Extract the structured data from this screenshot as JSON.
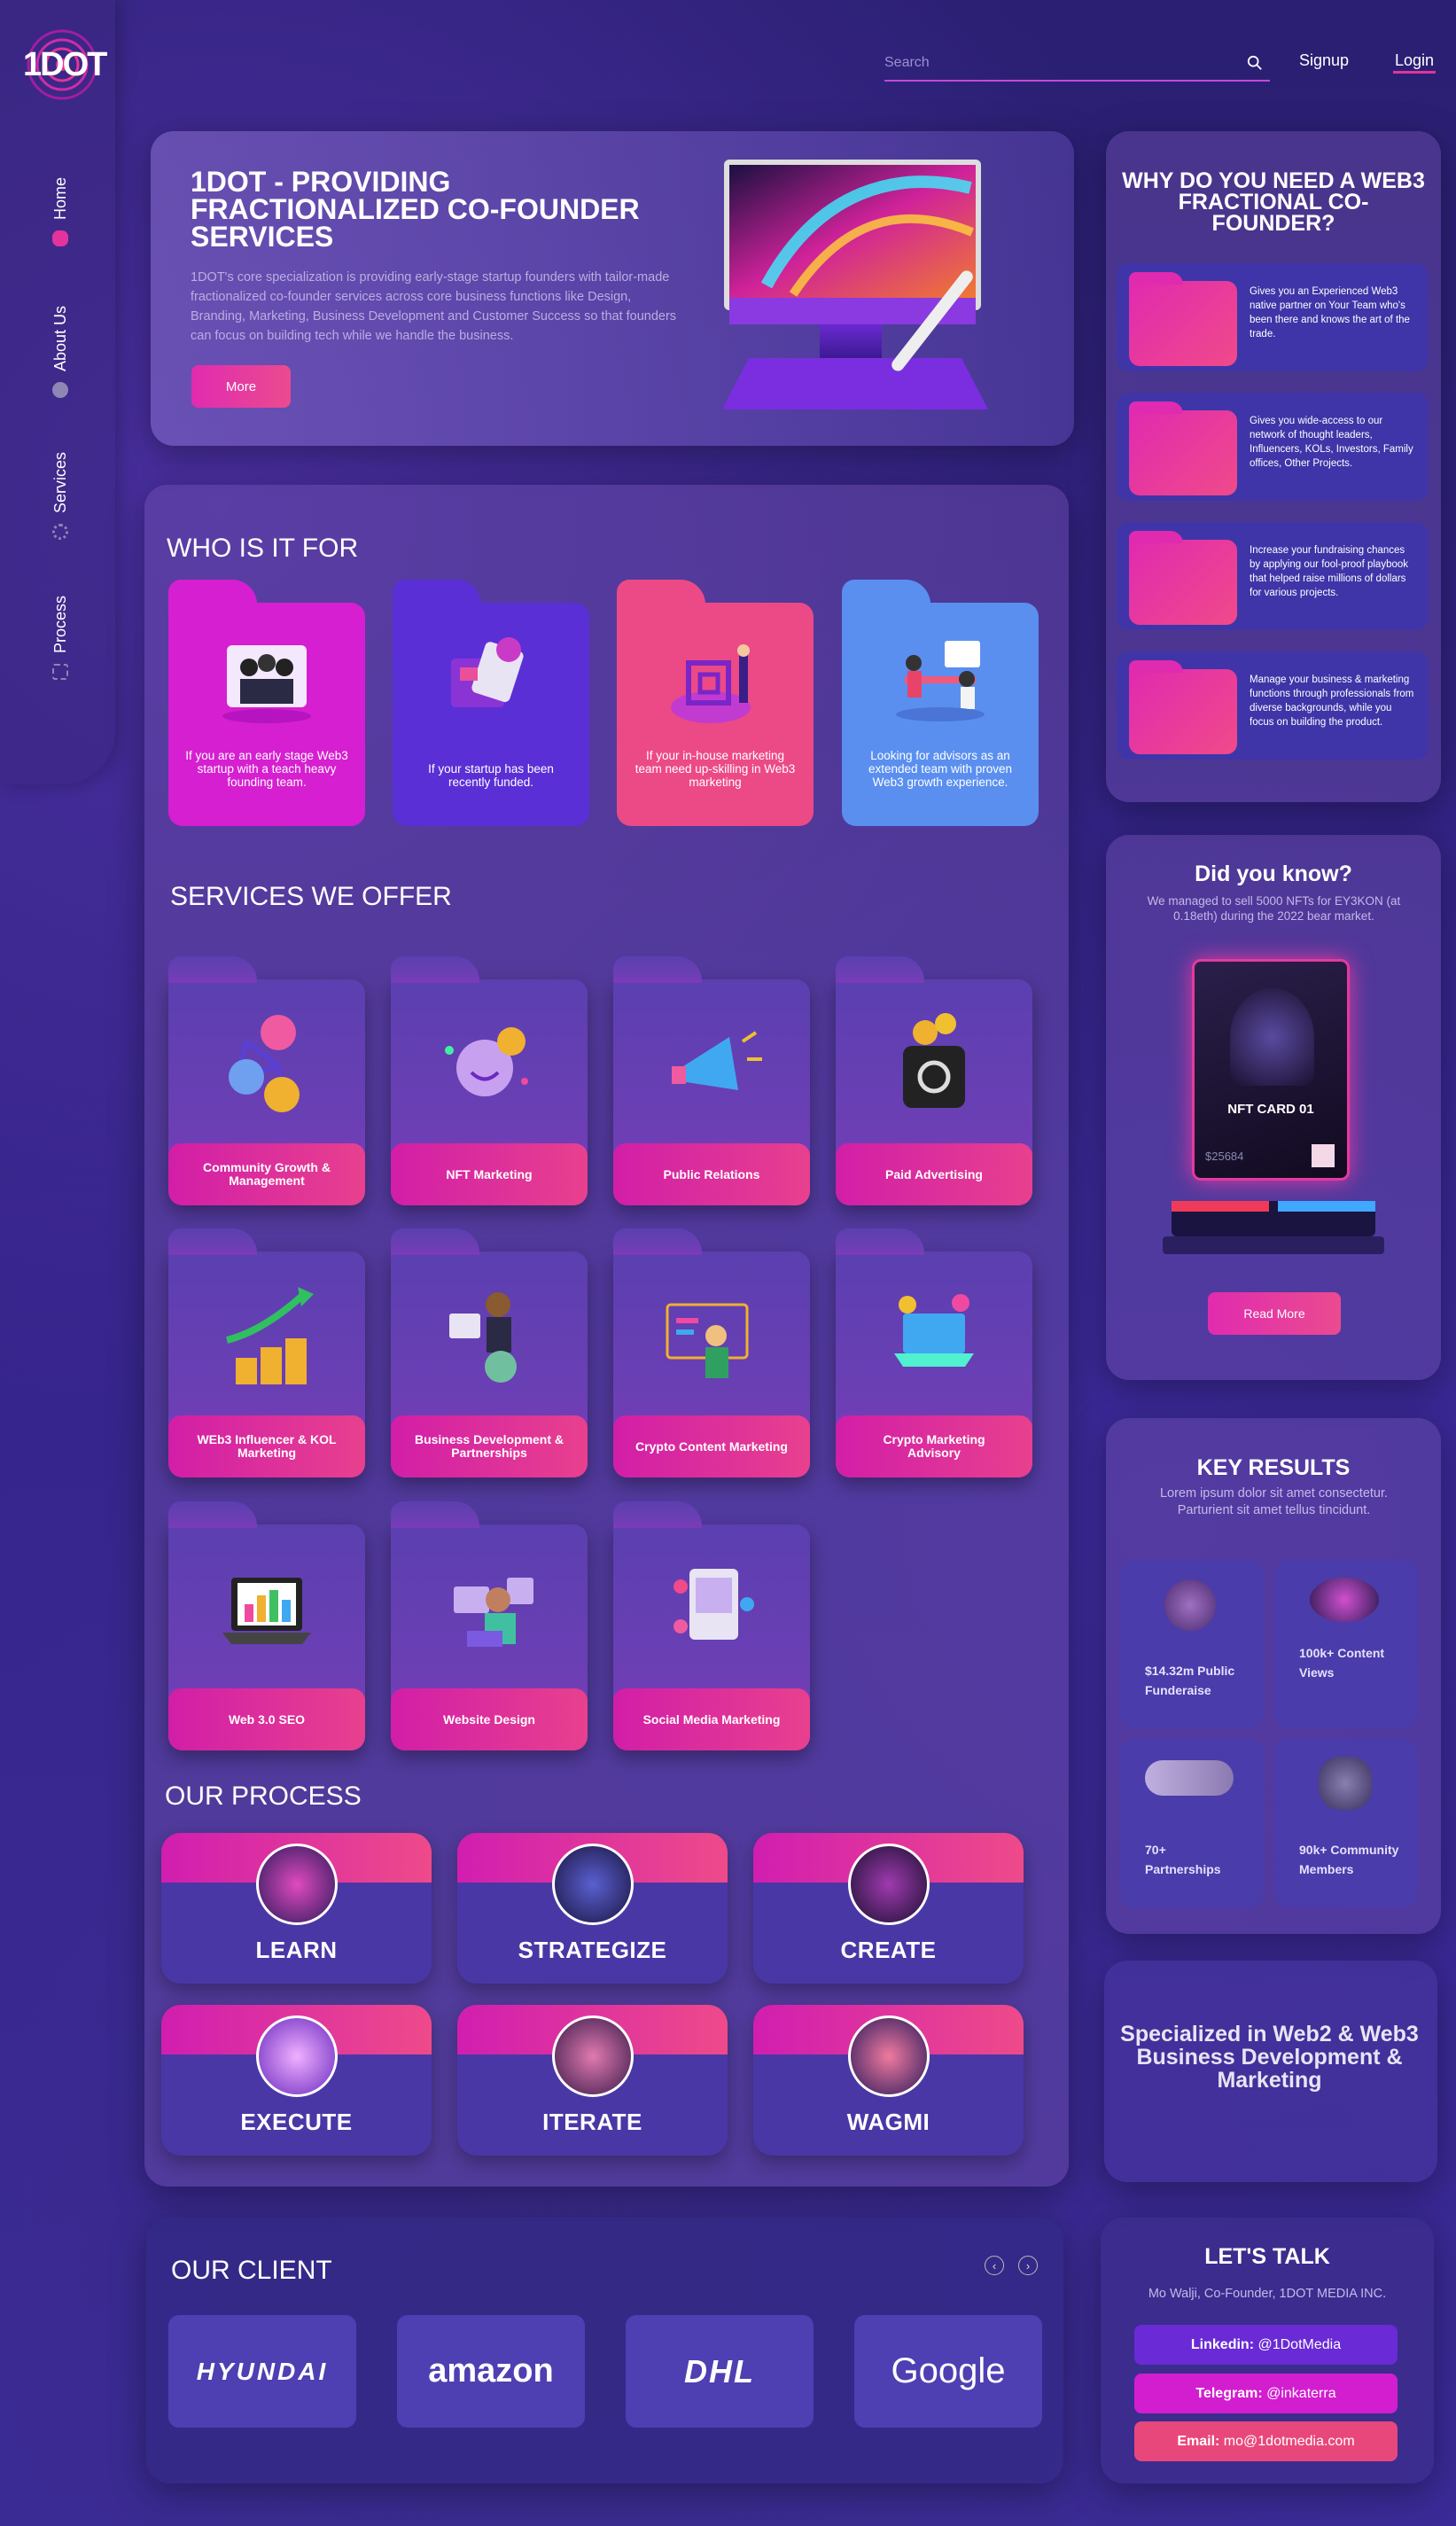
{
  "brand": {
    "logo_text": "1DOT"
  },
  "nav": {
    "items": [
      {
        "label": "Home"
      },
      {
        "label": "About Us"
      },
      {
        "label": "Services"
      },
      {
        "label": "Process"
      }
    ]
  },
  "header": {
    "search_placeholder": "Search",
    "signup": "Signup",
    "login": "Login"
  },
  "hero": {
    "title": "1DOT - PROVIDING FRACTIONALIZED CO-FOUNDER SERVICES",
    "description": "1DOT's core specialization is providing early-stage startup founders with tailor-made fractionalized co-founder services across core business functions like Design, Branding, Marketing, Business Development and Customer Success so that founders can focus on building tech while we handle the business.",
    "button": "More"
  },
  "who": {
    "title": "WHO IS IT FOR",
    "cards": [
      {
        "text": "If you are an early stage Web3 startup with a teach heavy founding team.",
        "color": "#d61fd0"
      },
      {
        "text": "If your startup has been recently funded.",
        "color": "#5b2fd6"
      },
      {
        "text": "If your in-house marketing team need up-skilling in Web3 marketing",
        "color": "#ec4a86"
      },
      {
        "text": "Looking for advisors as an extended team with proven Web3 growth experience.",
        "color": "#5a8ff0"
      }
    ]
  },
  "services": {
    "title": "SERVICES WE OFFER",
    "items": [
      {
        "label": "Community Growth & Management"
      },
      {
        "label": "NFT Marketing"
      },
      {
        "label": "Public Relations"
      },
      {
        "label": "Paid Advertising"
      },
      {
        "label": "WEb3 Influencer & KOL Marketing"
      },
      {
        "label": "Business Development & Partnerships"
      },
      {
        "label": "Crypto Content Marketing"
      },
      {
        "label": "Crypto Marketing Advisory"
      },
      {
        "label": "Web 3.0 SEO"
      },
      {
        "label": "Website Design"
      },
      {
        "label": "Social Media Marketing"
      }
    ]
  },
  "process": {
    "title": "OUR PROCESS",
    "steps": [
      {
        "label": "LEARN"
      },
      {
        "label": "STRATEGIZE"
      },
      {
        "label": "CREATE"
      },
      {
        "label": "EXECUTE"
      },
      {
        "label": "ITERATE"
      },
      {
        "label": "WAGMI"
      }
    ]
  },
  "why": {
    "title": "WHY DO YOU NEED A WEB3 FRACTIONAL CO-FOUNDER?",
    "items": [
      {
        "text": "Gives you an Experienced Web3 native partner on Your Team who's been there and knows the art of the trade."
      },
      {
        "text": "Gives you wide-access to our network of thought leaders, Influencers, KOLs, Investors, Family offices, Other Projects."
      },
      {
        "text": "Increase your fundraising chances by applying our fool-proof playbook that helped raise millions of dollars for various projects."
      },
      {
        "text": "Manage your business & marketing functions through professionals from diverse backgrounds, while you focus on building the product."
      }
    ]
  },
  "did_you_know": {
    "title": "Did you know?",
    "description": "We managed to sell 5000 NFTs for EY3KON (at 0.18eth) during the 2022 bear market.",
    "nft_title": "NFT CARD 01",
    "nft_price": "$25684",
    "button": "Read More"
  },
  "results": {
    "title": "KEY RESULTS",
    "description": "Lorem ipsum dolor sit amet consectetur. Parturient sit amet tellus tincidunt.",
    "items": [
      {
        "line1": "$14.32m Public",
        "line2": "Funderaise"
      },
      {
        "line1": "100k+ Content",
        "line2": "Views"
      },
      {
        "line1": "70+",
        "line2": "Partnerships"
      },
      {
        "line1": "90k+ Community",
        "line2": "Members"
      }
    ]
  },
  "specialized": {
    "text": "Specialized in Web2 & Web3 Business Development & Marketing"
  },
  "talk": {
    "title": "LET'S TALK",
    "subtitle": "Mo Walji, Co-Founder, 1DOT MEDIA INC.",
    "linkedin_label": "Linkedin:",
    "linkedin_value": "@1DotMedia",
    "telegram_label": "Telegram:",
    "telegram_value": "@inkaterra",
    "email_label": "Email:",
    "email_value": "mo@1dotmedia.com"
  },
  "clients": {
    "title": "OUR CLIENT",
    "items": [
      {
        "name": "HYUNDAI"
      },
      {
        "name": "amazon"
      },
      {
        "name": "DHL"
      },
      {
        "name": "Google"
      }
    ]
  },
  "colors": {
    "accent": "#e3349d",
    "panel": "#4a37a6"
  }
}
